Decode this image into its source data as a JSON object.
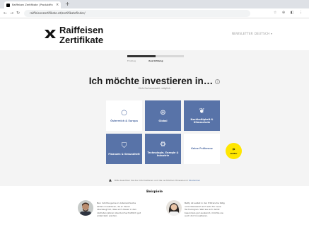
{
  "browser": {
    "tab_title": "Raiffeisen Zertifikate | Produktfinder",
    "tab_close": "×",
    "new_tab": "+",
    "url": "raiffeisenzertifikate.at/zertifikatefinder/",
    "nav_back": "←",
    "nav_forward": "→",
    "nav_reload": "↻",
    "toolbar_icons": "☆ ⊕ ◧ ⋮"
  },
  "header": {
    "logo_line1": "Raiffeisen",
    "logo_line2": "Zertifikate",
    "nav_link_1": "NEWSLETTER",
    "nav_link_2": "DEUTSCH ▾"
  },
  "progress": {
    "value_fraction": 0.5,
    "step_left": "Einstieg",
    "step_current": "Ausrichtung"
  },
  "main": {
    "headline": "Ich möchte investieren in…",
    "info_icon": "i",
    "subline": "Mehrfachauswahl möglich"
  },
  "tiles": [
    {
      "icon": "○",
      "label": "Österreich & Europa",
      "style": "white"
    },
    {
      "icon": "⊕",
      "label": "Global",
      "style": "blue"
    },
    {
      "icon": "❦",
      "label": "Nachhaltigkeit & Klimaschutz",
      "style": "blue"
    },
    {
      "icon": "⛉",
      "label": "Finanzen & Gesundheit",
      "style": "blue"
    },
    {
      "icon": "⚙",
      "label": "Technologie, Energie & Industrie",
      "style": "blue"
    },
    {
      "icon": "",
      "label": "Keine Präferenz",
      "style": "white"
    }
  ],
  "weiter": {
    "arrow": "»",
    "label": "weiter"
  },
  "notice": {
    "icon": "▲",
    "text": "Bitte beachten Sie die Informationen und die rechtlichen Hinweise im",
    "link": "Disclaimer"
  },
  "examples": {
    "title": "Beispiele",
    "items": [
      {
        "text": "Ben möchte gerne in österreichische Aktien investieren, da er davon überzeugt ist, dass sich dieser in den nächsten Jahren überdurchschnittlich gut entwickeln werden."
      },
      {
        "text": "Betty ist selbst in der IT-Branche tätig und interessiert sich sehr für neue Technologien. Weil sie sich damit besonders gut auskennt, möchte sie auch dort investieren."
      }
    ]
  },
  "colors": {
    "tile_blue": "#5873a8",
    "accent_yellow": "#ffe600",
    "background": "#f4f4f4"
  }
}
